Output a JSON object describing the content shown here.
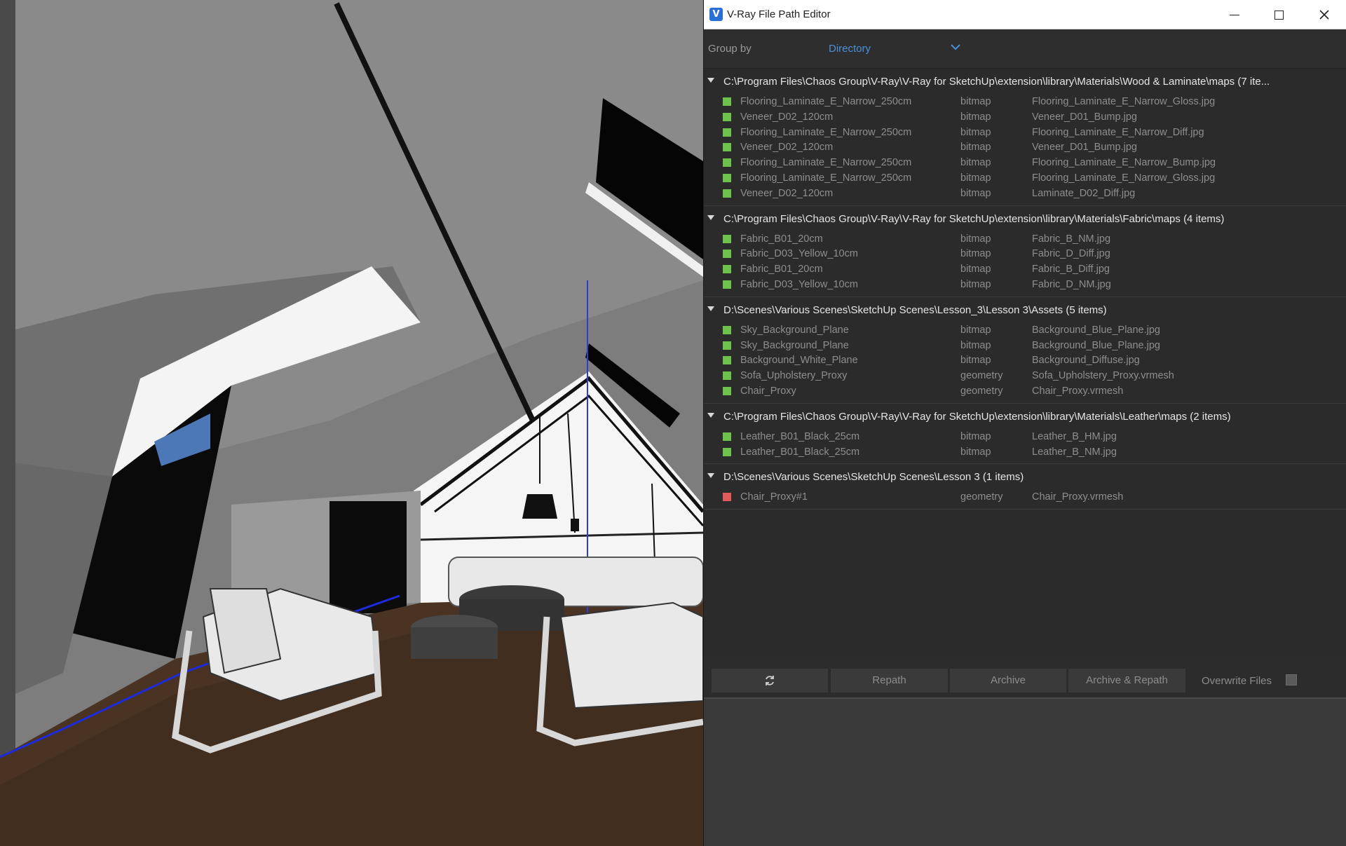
{
  "window": {
    "title": "V-Ray File Path Editor",
    "icon": "vray-logo-icon"
  },
  "toolbar": {
    "group_by_label": "Group by",
    "group_by_value": "Directory"
  },
  "groups": [
    {
      "path": "C:\\Program Files\\Chaos Group\\V-Ray\\V-Ray for SketchUp\\extension\\library\\Materials\\Wood & Laminate\\maps (7 ite...",
      "rows": [
        {
          "status": "ok",
          "name": "Flooring_Laminate_E_Narrow_250cm",
          "type": "bitmap",
          "file": "Flooring_Laminate_E_Narrow_Gloss.jpg"
        },
        {
          "status": "ok",
          "name": "Veneer_D02_120cm",
          "type": "bitmap",
          "file": "Veneer_D01_Bump.jpg"
        },
        {
          "status": "ok",
          "name": "Flooring_Laminate_E_Narrow_250cm",
          "type": "bitmap",
          "file": "Flooring_Laminate_E_Narrow_Diff.jpg"
        },
        {
          "status": "ok",
          "name": "Veneer_D02_120cm",
          "type": "bitmap",
          "file": "Veneer_D01_Bump.jpg"
        },
        {
          "status": "ok",
          "name": "Flooring_Laminate_E_Narrow_250cm",
          "type": "bitmap",
          "file": "Flooring_Laminate_E_Narrow_Bump.jpg"
        },
        {
          "status": "ok",
          "name": "Flooring_Laminate_E_Narrow_250cm",
          "type": "bitmap",
          "file": "Flooring_Laminate_E_Narrow_Gloss.jpg"
        },
        {
          "status": "ok",
          "name": "Veneer_D02_120cm",
          "type": "bitmap",
          "file": "Laminate_D02_Diff.jpg"
        }
      ]
    },
    {
      "path": "C:\\Program Files\\Chaos Group\\V-Ray\\V-Ray for SketchUp\\extension\\library\\Materials\\Fabric\\maps (4 items)",
      "rows": [
        {
          "status": "ok",
          "name": "Fabric_B01_20cm",
          "type": "bitmap",
          "file": "Fabric_B_NM.jpg"
        },
        {
          "status": "ok",
          "name": "Fabric_D03_Yellow_10cm",
          "type": "bitmap",
          "file": "Fabric_D_Diff.jpg"
        },
        {
          "status": "ok",
          "name": "Fabric_B01_20cm",
          "type": "bitmap",
          "file": "Fabric_B_Diff.jpg"
        },
        {
          "status": "ok",
          "name": "Fabric_D03_Yellow_10cm",
          "type": "bitmap",
          "file": "Fabric_D_NM.jpg"
        }
      ]
    },
    {
      "path": "D:\\Scenes\\Various Scenes\\SketchUp Scenes\\Lesson_3\\Lesson 3\\Assets (5 items)",
      "rows": [
        {
          "status": "ok",
          "name": "Sky_Background_Plane",
          "type": "bitmap",
          "file": "Background_Blue_Plane.jpg"
        },
        {
          "status": "ok",
          "name": "Sky_Background_Plane",
          "type": "bitmap",
          "file": "Background_Blue_Plane.jpg"
        },
        {
          "status": "ok",
          "name": "Background_White_Plane",
          "type": "bitmap",
          "file": "Background_Diffuse.jpg"
        },
        {
          "status": "ok",
          "name": "Sofa_Upholstery_Proxy",
          "type": "geometry",
          "file": "Sofa_Upholstery_Proxy.vrmesh"
        },
        {
          "status": "ok",
          "name": "Chair_Proxy",
          "type": "geometry",
          "file": "Chair_Proxy.vrmesh"
        }
      ]
    },
    {
      "path": "C:\\Program Files\\Chaos Group\\V-Ray\\V-Ray for SketchUp\\extension\\library\\Materials\\Leather\\maps (2 items)",
      "rows": [
        {
          "status": "ok",
          "name": "Leather_B01_Black_25cm",
          "type": "bitmap",
          "file": "Leather_B_HM.jpg"
        },
        {
          "status": "ok",
          "name": "Leather_B01_Black_25cm",
          "type": "bitmap",
          "file": "Leather_B_NM.jpg"
        }
      ]
    },
    {
      "path": "D:\\Scenes\\Various Scenes\\SketchUp Scenes\\Lesson 3 (1 items)",
      "rows": [
        {
          "status": "err",
          "name": "Chair_Proxy#1",
          "type": "geometry",
          "file": "Chair_Proxy.vrmesh"
        }
      ]
    }
  ],
  "actions": {
    "refresh_icon": "refresh-icon",
    "repath_label": "Repath",
    "archive_label": "Archive",
    "archive_repath_label": "Archive & Repath",
    "overwrite_label": "Overwrite Files",
    "overwrite_checked": false
  },
  "colors": {
    "status_ok": "#6cc24a",
    "status_error": "#e05a5a",
    "accent": "#4a90d9"
  }
}
